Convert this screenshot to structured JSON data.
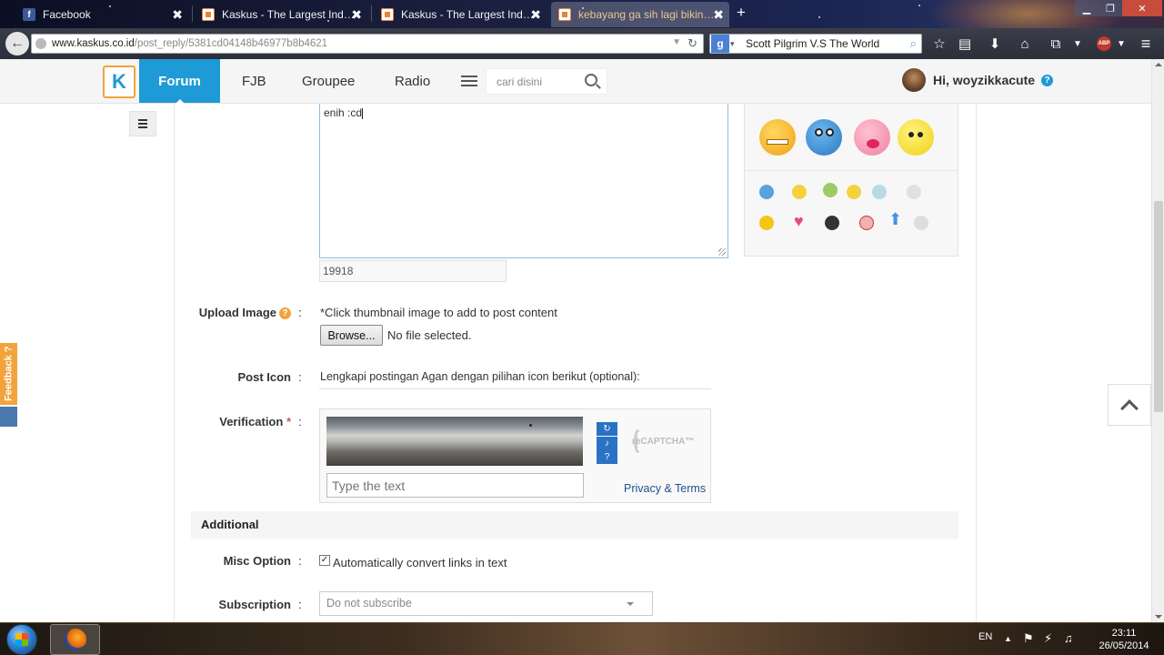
{
  "browser": {
    "tabs": [
      {
        "label": "Facebook",
        "icon": "facebook-icon"
      },
      {
        "label": "Kaskus - The Largest Indon...",
        "icon": "kaskus-icon"
      },
      {
        "label": "Kaskus - The Largest Indon...",
        "icon": "kaskus-icon"
      },
      {
        "label": "kebayang ga sih lagi bikin ...",
        "icon": "kaskus-icon",
        "active": true
      }
    ],
    "tab_close_glyph": "✖",
    "new_tab_glyph": "+",
    "url_host": "www.kaskus.co.id",
    "url_path": "/post_reply/5381cd04148b46977b8b4621",
    "search_engine_letter": "g",
    "search_text": "Scott Pilgrim V.S The World",
    "adblock_label": "ABP"
  },
  "site": {
    "logo_letter": "K",
    "nav": [
      "Forum",
      "FJB",
      "Groupee",
      "Radio"
    ],
    "search_placeholder": "cari disini",
    "greeting": "Hi, woyzikkacute",
    "help_glyph": "?"
  },
  "editor": {
    "text": "enih :cd",
    "char_count": "19918"
  },
  "form": {
    "upload_label": "Upload Image",
    "upload_hint": "*Click thumbnail image to add to post content",
    "browse_label": "Browse...",
    "no_file": "No file selected.",
    "post_icon_label": "Post Icon",
    "post_icon_text": "Lengkapi postingan Agan dengan pilihan icon berikut (optional):",
    "verification_label": "Verification",
    "required_mark": "*",
    "colon": ":",
    "captcha_placeholder": "Type the text",
    "captcha_logo": "reCAPTCHA™",
    "privacy_link": "Privacy & Terms",
    "additional_heading": "Additional",
    "misc_label": "Misc Option",
    "misc_checkbox_text": "Automatically convert links in text",
    "misc_checked": true,
    "subscription_label": "Subscription",
    "subscription_value": "Do not subscribe"
  },
  "widgets": {
    "feedback_label": "Feedback ?"
  },
  "taskbar": {
    "language": "EN",
    "time": "23:11",
    "date": "26/05/2014"
  },
  "colors": {
    "kaskus_blue": "#1e9ad6",
    "kaskus_orange": "#f2a33c"
  }
}
